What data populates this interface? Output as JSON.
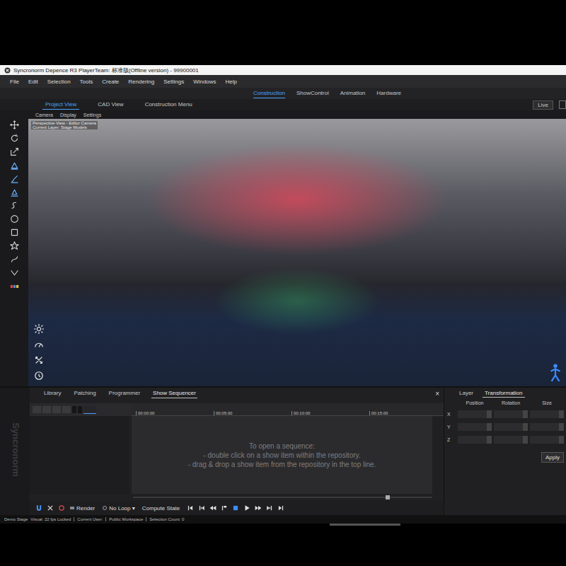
{
  "window": {
    "title": "Syncronorm Depence R3  PlayerTeam: 标准版(Offline version) - 99900001"
  },
  "menu": [
    "File",
    "Edit",
    "Selection",
    "Tools",
    "Create",
    "Rendering",
    "Settings",
    "Windows",
    "Help"
  ],
  "modes": [
    {
      "label": "Construction",
      "selected": true
    },
    {
      "label": "ShowControl",
      "selected": false
    },
    {
      "label": "Animation",
      "selected": false
    },
    {
      "label": "Hardware",
      "selected": false
    }
  ],
  "view_tabs": [
    {
      "label": "Project View",
      "selected": true
    },
    {
      "label": "CAD View",
      "selected": false
    },
    {
      "label": "Construction Menu",
      "selected": false
    }
  ],
  "live_button": "Live",
  "view_menu": [
    "Camera",
    "Display",
    "Settings"
  ],
  "viewport": {
    "overlay": [
      "Perspective View - Editor Camera",
      "Current Layer: Stage Models"
    ]
  },
  "bottom_tabs": [
    {
      "label": "Library",
      "selected": false
    },
    {
      "label": "Patching",
      "selected": false
    },
    {
      "label": "Programmer",
      "selected": false
    },
    {
      "label": "Show Sequencer",
      "selected": true
    }
  ],
  "close": "×",
  "watermark": "Syncronorm",
  "timeline": {
    "ticks": [
      "00:00:00",
      "00:05:00",
      "00:10:00",
      "00:15:00"
    ],
    "hint": [
      "To open a sequence:",
      "- double click on a show item within the repository.",
      "- drag & drop a show item from the repository in the top line."
    ]
  },
  "transport": {
    "render": "Render",
    "loop": "No Loop",
    "loop_arrow": "▾",
    "compute": "Compute State"
  },
  "inspector": {
    "tabs": [
      {
        "label": "Layer",
        "selected": false
      },
      {
        "label": "Transformation",
        "selected": true
      }
    ],
    "columns": [
      "Position",
      "Rotation",
      "Size"
    ],
    "axes": [
      "X",
      "Y",
      "Z"
    ],
    "apply": "Apply"
  },
  "status_bar": [
    "Demo Stage",
    "Visual: 22 fps Locked",
    "Current User:",
    "Public Workspace",
    "Selection Count: 0"
  ]
}
